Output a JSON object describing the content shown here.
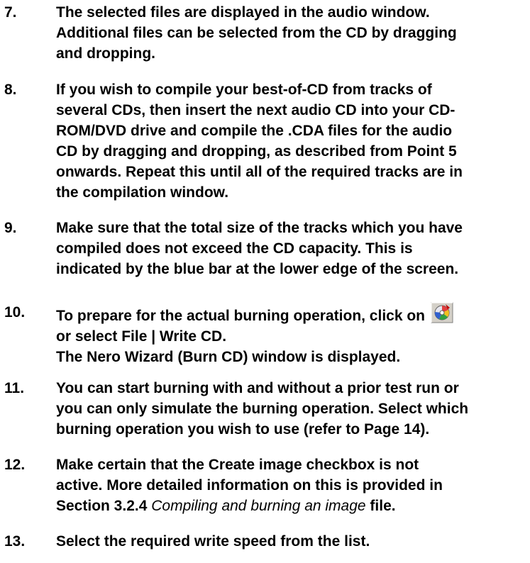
{
  "steps": [
    {
      "number": "7.",
      "lines": [
        "The selected files are displayed in the audio window.",
        "Additional files can be selected from the CD by dragging",
        "and dropping."
      ]
    },
    {
      "number": "8.",
      "lines": [
        "If you wish to compile your best-of-CD from tracks of",
        "several CDs, then insert the next audio CD into your CD-",
        "ROM/DVD drive and compile the .CDA files for the audio",
        "CD by dragging and dropping, as described from Point 5",
        "onwards. Repeat this until all of the required tracks are in",
        "the compilation window."
      ]
    },
    {
      "number": "9.",
      "lines": [
        "Make sure that the total size of the tracks which you have",
        "compiled does not exceed the CD capacity. This is",
        "indicated by the blue bar at the lower edge of the screen."
      ]
    },
    {
      "number": "10.",
      "line1": "To prepare for the actual burning operation, click on",
      "icon": "burn-cd-icon",
      "line2": "or select File | Write CD.",
      "line3": "The Nero Wizard (Burn CD) window is displayed."
    },
    {
      "number": "11.",
      "lines": [
        "You can start burning with and without a prior test run or",
        "you can only simulate the burning operation. Select which",
        "burning operation you wish to use (refer to Page 14)."
      ]
    },
    {
      "number": "12.",
      "line1": "Make certain that the Create image checkbox is not",
      "line2": "active. More detailed information on this is provided in",
      "line3_prefix": "Section 3.2.4 ",
      "line3_italic": "Compiling and burning an image",
      "line3_suffix": " file."
    },
    {
      "number": "13.",
      "lines": [
        "Select the required write speed from the list."
      ]
    }
  ]
}
